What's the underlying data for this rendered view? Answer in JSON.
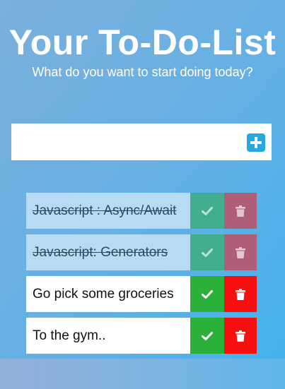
{
  "header": {
    "title": "Your To-Do-List",
    "subtitle": "What do you want to start doing today?"
  },
  "new_todo": {
    "value": "",
    "placeholder": "",
    "add_icon": "plus-icon"
  },
  "todos": [
    {
      "text": "Javascript : Async/Await",
      "completed": true
    },
    {
      "text": "Javascript: Generators",
      "completed": true
    },
    {
      "text": "Go pick some groceries",
      "completed": false
    },
    {
      "text": "To the gym..",
      "completed": false
    }
  ],
  "icons": {
    "complete": "check-icon",
    "remove": "trash-icon"
  },
  "colors": {
    "complete": "#2bb03a",
    "remove": "#f80f0f",
    "add": "#25a8e0",
    "completed_row": "#b6dbf2"
  }
}
